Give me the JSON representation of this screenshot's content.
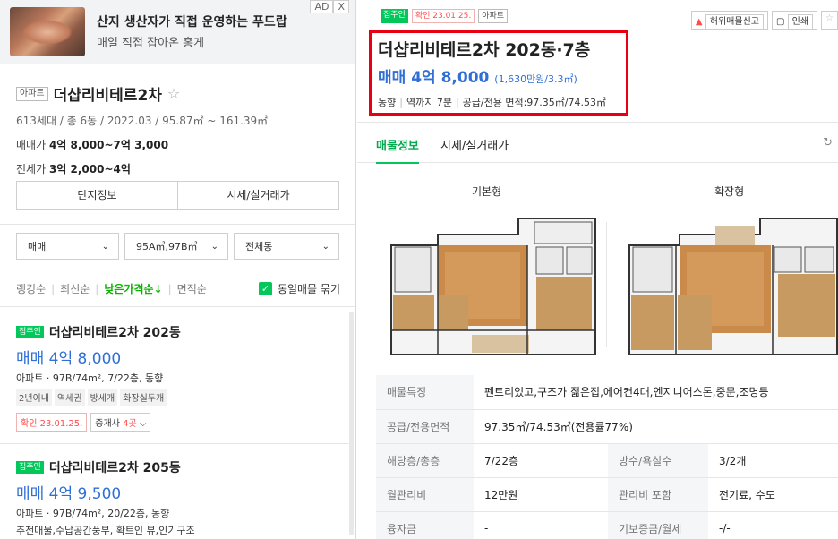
{
  "ad": {
    "title": "산지 생산자가 직접 운영하는 푸드랍",
    "subtitle": "매일 직접 잡아온 홍게",
    "ad_label": "AD",
    "close_label": "X"
  },
  "complex": {
    "type_tag": "아파트",
    "name": "더샵리비테르2차",
    "star": "☆",
    "meta": "613세대 / 총 6동 / 2022.03 / 95.87㎡ ~ 161.39㎡",
    "sale_label": "매매가",
    "sale_value": "4억 8,000~7억 3,000",
    "jeonse_label": "전세가",
    "jeonse_value": "3억 2,000~4억",
    "btn_info": "단지정보",
    "btn_market": "시세/실거래가"
  },
  "filters": [
    {
      "label": "매매"
    },
    {
      "label": "95A㎡,97B㎡"
    },
    {
      "label": "전체동"
    }
  ],
  "sort": {
    "items": [
      "랭킹순",
      "최신순",
      "낮은가격순↓",
      "면적순"
    ],
    "active_index": 2,
    "checkbox_label": "동일매물 묶기"
  },
  "listings": [
    {
      "badge": "집주인",
      "name": "더샵리비테르2차 202동",
      "price": "매매 4억 8,000",
      "desc": "아파트 · 97B/74m², 7/22층, 동향",
      "tags": [
        "2년이내",
        "역세권",
        "방세개",
        "화장실두개"
      ],
      "confirm": "확인 23.01.25.",
      "agents_prefix": "중개사 ",
      "agents_count": "4곳",
      "agents_suffix": " ⌵"
    },
    {
      "badge": "집주인",
      "name": "더샵리비테르2차 205동",
      "price": "매매 4억 9,500",
      "desc": "아파트 · 97B/74m², 20/22층, 동향",
      "extra": "추천매물,수납공간풍부, 확트인 뷰,인기구조"
    }
  ],
  "detail": {
    "badges": [
      "집주인",
      "확인 23.01.25.",
      "아파트"
    ],
    "actions": {
      "report": "허위매물신고",
      "print": "인쇄",
      "fav": "☆"
    },
    "title": "더샵리비테르2차 202동·7층",
    "price": "매매 4억 8,000",
    "price_sub": "(1,630만원/3.3㎡)",
    "info": [
      "동향",
      "역까지 7분",
      "공급/전용 면적:97.35㎡/74.53㎡"
    ],
    "tabs": [
      "매물정보",
      "시세/실거래가"
    ],
    "refresh_icon": "↻",
    "floorplan_labels": [
      "기본형",
      "확장형"
    ],
    "specs": [
      {
        "k": "매물특징",
        "v": "펜트리있고,구조가 젊은집,에어컨4대,엔지니어스톤,중문,조명등"
      },
      {
        "k": "공급/전용면적",
        "v": "97.35㎡/74.53㎡(전용률77%)"
      },
      {
        "k": "해당층/총층",
        "v": "7/22층",
        "k2": "방수/욕실수",
        "v2": "3/2개"
      },
      {
        "k": "월관리비",
        "v": "12만원",
        "k2": "관리비 포함",
        "v2": "전기료, 수도"
      },
      {
        "k": "융자금",
        "v": "-",
        "k2": "기보증금/월세",
        "v2": "-/-"
      }
    ]
  },
  "colors": {
    "accent_green": "#03c75a",
    "price_blue": "#2f6fd6",
    "highlight_red": "#e60012",
    "confirm_red": "#ff4d4d"
  }
}
